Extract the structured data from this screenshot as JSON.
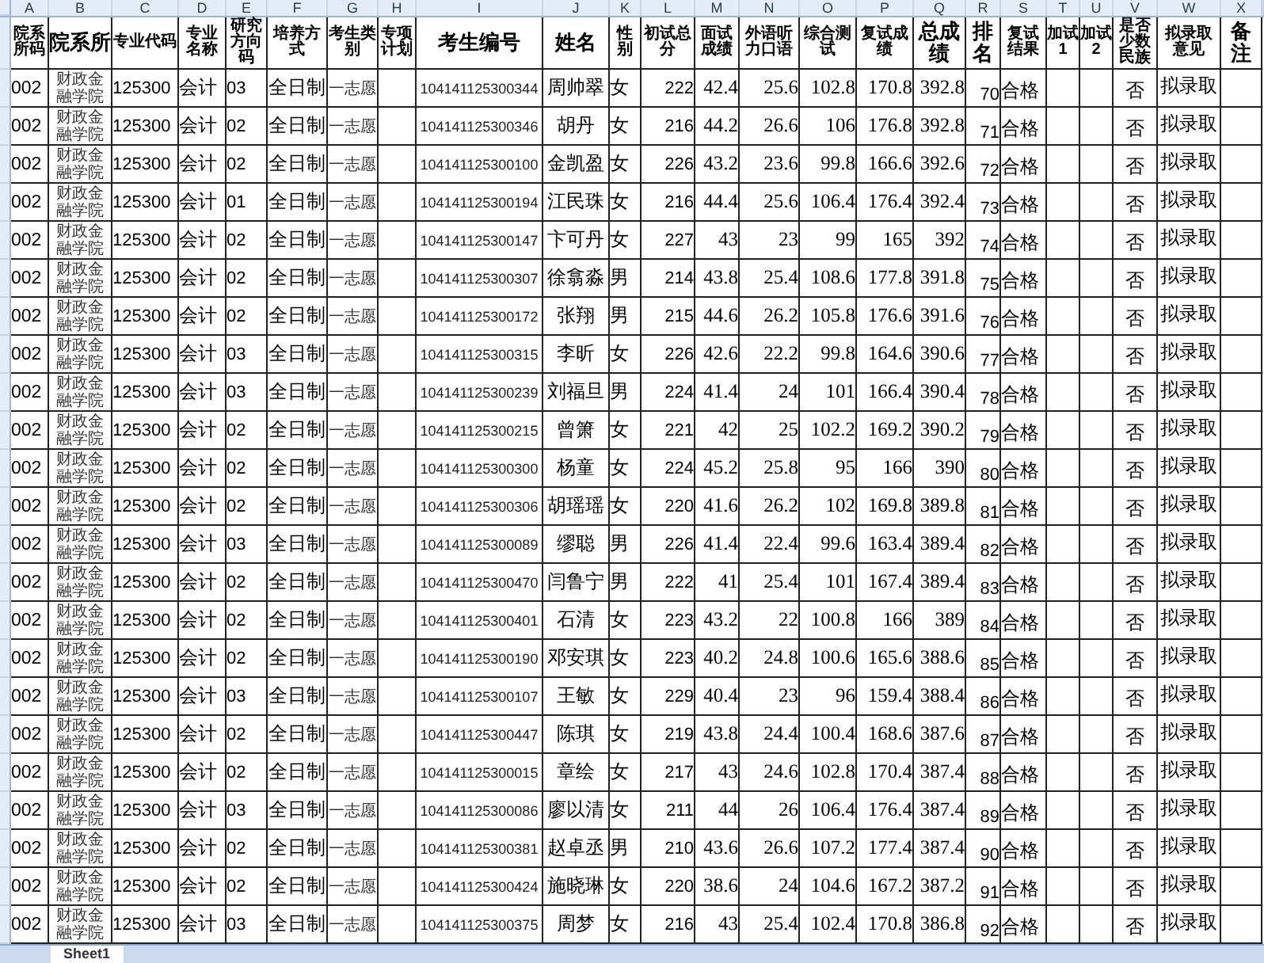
{
  "sheet": {
    "column_letters": [
      "A",
      "B",
      "C",
      "D",
      "E",
      "F",
      "G",
      "H",
      "I",
      "J",
      "K",
      "L",
      "M",
      "N",
      "O",
      "P",
      "Q",
      "R",
      "S",
      "T",
      "U",
      "V",
      "W",
      "X"
    ],
    "headers": [
      "院系所码",
      "院系所",
      "专业代码",
      "专业名称",
      "研究方向码",
      "培养方式",
      "考生类别",
      "专项计划",
      "考生编号",
      "姓名",
      "性别",
      "初试总分",
      "面试成绩",
      "外语听力口语",
      "综合测试",
      "复试成绩",
      "总成绩",
      "排名",
      "复试结果",
      "加试1",
      "加试2",
      "是否少数民族",
      "拟录取意见",
      "备注"
    ],
    "rows": [
      {
        "dept_code": "002",
        "dept": "财政金融学院",
        "major_code": "125300",
        "major": "会计",
        "direction": "03",
        "mode": "全日制",
        "category": "一志愿",
        "exam_id": "104141125300344",
        "name": "周帅翠",
        "gender": "女",
        "initial_total": "222",
        "column_m": "42.4",
        "column_n": "25.6",
        "comprehensive": "102.8",
        "retest": "170.8",
        "total": "392.8",
        "rank": "70",
        "result": "合格",
        "column_v": "否",
        "decision": "拟录取"
      },
      {
        "dept_code": "002",
        "dept": "财政金融学院",
        "major_code": "125300",
        "major": "会计",
        "direction": "02",
        "mode": "全日制",
        "category": "一志愿",
        "exam_id": "104141125300346",
        "name": "胡丹",
        "gender": "女",
        "initial_total": "216",
        "column_m": "44.2",
        "column_n": "26.6",
        "comprehensive": "106",
        "retest": "176.8",
        "total": "392.8",
        "rank": "71",
        "result": "合格",
        "column_v": "否",
        "decision": "拟录取"
      },
      {
        "dept_code": "002",
        "dept": "财政金融学院",
        "major_code": "125300",
        "major": "会计",
        "direction": "02",
        "mode": "全日制",
        "category": "一志愿",
        "exam_id": "104141125300100",
        "name": "金凯盈",
        "gender": "女",
        "initial_total": "226",
        "column_m": "43.2",
        "column_n": "23.6",
        "comprehensive": "99.8",
        "retest": "166.6",
        "total": "392.6",
        "rank": "72",
        "result": "合格",
        "column_v": "否",
        "decision": "拟录取"
      },
      {
        "dept_code": "002",
        "dept": "财政金融学院",
        "major_code": "125300",
        "major": "会计",
        "direction": "01",
        "mode": "全日制",
        "category": "一志愿",
        "exam_id": "104141125300194",
        "name": "江民珠",
        "gender": "女",
        "initial_total": "216",
        "column_m": "44.4",
        "column_n": "25.6",
        "comprehensive": "106.4",
        "retest": "176.4",
        "total": "392.4",
        "rank": "73",
        "result": "合格",
        "column_v": "否",
        "decision": "拟录取"
      },
      {
        "dept_code": "002",
        "dept": "财政金融学院",
        "major_code": "125300",
        "major": "会计",
        "direction": "02",
        "mode": "全日制",
        "category": "一志愿",
        "exam_id": "104141125300147",
        "name": "卞可丹",
        "gender": "女",
        "initial_total": "227",
        "column_m": "43",
        "column_n": "23",
        "comprehensive": "99",
        "retest": "165",
        "total": "392",
        "rank": "74",
        "result": "合格",
        "column_v": "否",
        "decision": "拟录取"
      },
      {
        "dept_code": "002",
        "dept": "财政金融学院",
        "major_code": "125300",
        "major": "会计",
        "direction": "02",
        "mode": "全日制",
        "category": "一志愿",
        "exam_id": "104141125300307",
        "name": "徐翕淼",
        "gender": "男",
        "initial_total": "214",
        "column_m": "43.8",
        "column_n": "25.4",
        "comprehensive": "108.6",
        "retest": "177.8",
        "total": "391.8",
        "rank": "75",
        "result": "合格",
        "column_v": "否",
        "decision": "拟录取"
      },
      {
        "dept_code": "002",
        "dept": "财政金融学院",
        "major_code": "125300",
        "major": "会计",
        "direction": "02",
        "mode": "全日制",
        "category": "一志愿",
        "exam_id": "104141125300172",
        "name": "张翔",
        "gender": "男",
        "initial_total": "215",
        "column_m": "44.6",
        "column_n": "26.2",
        "comprehensive": "105.8",
        "retest": "176.6",
        "total": "391.6",
        "rank": "76",
        "result": "合格",
        "column_v": "否",
        "decision": "拟录取"
      },
      {
        "dept_code": "002",
        "dept": "财政金融学院",
        "major_code": "125300",
        "major": "会计",
        "direction": "03",
        "mode": "全日制",
        "category": "一志愿",
        "exam_id": "104141125300315",
        "name": "李昕",
        "gender": "女",
        "initial_total": "226",
        "column_m": "42.6",
        "column_n": "22.2",
        "comprehensive": "99.8",
        "retest": "164.6",
        "total": "390.6",
        "rank": "77",
        "result": "合格",
        "column_v": "否",
        "decision": "拟录取"
      },
      {
        "dept_code": "002",
        "dept": "财政金融学院",
        "major_code": "125300",
        "major": "会计",
        "direction": "03",
        "mode": "全日制",
        "category": "一志愿",
        "exam_id": "104141125300239",
        "name": "刘福旦",
        "gender": "男",
        "initial_total": "224",
        "column_m": "41.4",
        "column_n": "24",
        "comprehensive": "101",
        "retest": "166.4",
        "total": "390.4",
        "rank": "78",
        "result": "合格",
        "column_v": "否",
        "decision": "拟录取"
      },
      {
        "dept_code": "002",
        "dept": "财政金融学院",
        "major_code": "125300",
        "major": "会计",
        "direction": "02",
        "mode": "全日制",
        "category": "一志愿",
        "exam_id": "104141125300215",
        "name": "曾箫",
        "gender": "女",
        "initial_total": "221",
        "column_m": "42",
        "column_n": "25",
        "comprehensive": "102.2",
        "retest": "169.2",
        "total": "390.2",
        "rank": "79",
        "result": "合格",
        "column_v": "否",
        "decision": "拟录取"
      },
      {
        "dept_code": "002",
        "dept": "财政金融学院",
        "major_code": "125300",
        "major": "会计",
        "direction": "02",
        "mode": "全日制",
        "category": "一志愿",
        "exam_id": "104141125300300",
        "name": "杨童",
        "gender": "女",
        "initial_total": "224",
        "column_m": "45.2",
        "column_n": "25.8",
        "comprehensive": "95",
        "retest": "166",
        "total": "390",
        "rank": "80",
        "result": "合格",
        "column_v": "否",
        "decision": "拟录取"
      },
      {
        "dept_code": "002",
        "dept": "财政金融学院",
        "major_code": "125300",
        "major": "会计",
        "direction": "02",
        "mode": "全日制",
        "category": "一志愿",
        "exam_id": "104141125300306",
        "name": "胡瑶瑶",
        "gender": "女",
        "initial_total": "220",
        "column_m": "41.6",
        "column_n": "26.2",
        "comprehensive": "102",
        "retest": "169.8",
        "total": "389.8",
        "rank": "81",
        "result": "合格",
        "column_v": "否",
        "decision": "拟录取"
      },
      {
        "dept_code": "002",
        "dept": "财政金融学院",
        "major_code": "125300",
        "major": "会计",
        "direction": "03",
        "mode": "全日制",
        "category": "一志愿",
        "exam_id": "104141125300089",
        "name": "缪聪",
        "gender": "男",
        "initial_total": "226",
        "column_m": "41.4",
        "column_n": "22.4",
        "comprehensive": "99.6",
        "retest": "163.4",
        "total": "389.4",
        "rank": "82",
        "result": "合格",
        "column_v": "否",
        "decision": "拟录取"
      },
      {
        "dept_code": "002",
        "dept": "财政金融学院",
        "major_code": "125300",
        "major": "会计",
        "direction": "02",
        "mode": "全日制",
        "category": "一志愿",
        "exam_id": "104141125300470",
        "name": "闫鲁宁",
        "gender": "男",
        "initial_total": "222",
        "column_m": "41",
        "column_n": "25.4",
        "comprehensive": "101",
        "retest": "167.4",
        "total": "389.4",
        "rank": "83",
        "result": "合格",
        "column_v": "否",
        "decision": "拟录取"
      },
      {
        "dept_code": "002",
        "dept": "财政金融学院",
        "major_code": "125300",
        "major": "会计",
        "direction": "02",
        "mode": "全日制",
        "category": "一志愿",
        "exam_id": "104141125300401",
        "name": "石清",
        "gender": "女",
        "initial_total": "223",
        "column_m": "43.2",
        "column_n": "22",
        "comprehensive": "100.8",
        "retest": "166",
        "total": "389",
        "rank": "84",
        "result": "合格",
        "column_v": "否",
        "decision": "拟录取"
      },
      {
        "dept_code": "002",
        "dept": "财政金融学院",
        "major_code": "125300",
        "major": "会计",
        "direction": "02",
        "mode": "全日制",
        "category": "一志愿",
        "exam_id": "104141125300190",
        "name": "邓安琪",
        "gender": "女",
        "initial_total": "223",
        "column_m": "40.2",
        "column_n": "24.8",
        "comprehensive": "100.6",
        "retest": "165.6",
        "total": "388.6",
        "rank": "85",
        "result": "合格",
        "column_v": "否",
        "decision": "拟录取"
      },
      {
        "dept_code": "002",
        "dept": "财政金融学院",
        "major_code": "125300",
        "major": "会计",
        "direction": "03",
        "mode": "全日制",
        "category": "一志愿",
        "exam_id": "104141125300107",
        "name": "王敏",
        "gender": "女",
        "initial_total": "229",
        "column_m": "40.4",
        "column_n": "23",
        "comprehensive": "96",
        "retest": "159.4",
        "total": "388.4",
        "rank": "86",
        "result": "合格",
        "column_v": "否",
        "decision": "拟录取"
      },
      {
        "dept_code": "002",
        "dept": "财政金融学院",
        "major_code": "125300",
        "major": "会计",
        "direction": "02",
        "mode": "全日制",
        "category": "一志愿",
        "exam_id": "104141125300447",
        "name": "陈琪",
        "gender": "女",
        "initial_total": "219",
        "column_m": "43.8",
        "column_n": "24.4",
        "comprehensive": "100.4",
        "retest": "168.6",
        "total": "387.6",
        "rank": "87",
        "result": "合格",
        "column_v": "否",
        "decision": "拟录取"
      },
      {
        "dept_code": "002",
        "dept": "财政金融学院",
        "major_code": "125300",
        "major": "会计",
        "direction": "02",
        "mode": "全日制",
        "category": "一志愿",
        "exam_id": "104141125300015",
        "name": "章绘",
        "gender": "女",
        "initial_total": "217",
        "column_m": "43",
        "column_n": "24.6",
        "comprehensive": "102.8",
        "retest": "170.4",
        "total": "387.4",
        "rank": "88",
        "result": "合格",
        "column_v": "否",
        "decision": "拟录取"
      },
      {
        "dept_code": "002",
        "dept": "财政金融学院",
        "major_code": "125300",
        "major": "会计",
        "direction": "03",
        "mode": "全日制",
        "category": "一志愿",
        "exam_id": "104141125300086",
        "name": "廖以清",
        "gender": "女",
        "initial_total": "211",
        "column_m": "44",
        "column_n": "26",
        "comprehensive": "106.4",
        "retest": "176.4",
        "total": "387.4",
        "rank": "89",
        "result": "合格",
        "column_v": "否",
        "decision": "拟录取"
      },
      {
        "dept_code": "002",
        "dept": "财政金融学院",
        "major_code": "125300",
        "major": "会计",
        "direction": "02",
        "mode": "全日制",
        "category": "一志愿",
        "exam_id": "104141125300381",
        "name": "赵卓丞",
        "gender": "男",
        "initial_total": "210",
        "column_m": "43.6",
        "column_n": "26.6",
        "comprehensive": "107.2",
        "retest": "177.4",
        "total": "387.4",
        "rank": "90",
        "result": "合格",
        "column_v": "否",
        "decision": "拟录取"
      },
      {
        "dept_code": "002",
        "dept": "财政金融学院",
        "major_code": "125300",
        "major": "会计",
        "direction": "02",
        "mode": "全日制",
        "category": "一志愿",
        "exam_id": "104141125300424",
        "name": "施晓琳",
        "gender": "女",
        "initial_total": "220",
        "column_m": "38.6",
        "column_n": "24",
        "comprehensive": "104.6",
        "retest": "167.2",
        "total": "387.2",
        "rank": "91",
        "result": "合格",
        "column_v": "否",
        "decision": "拟录取"
      },
      {
        "dept_code": "002",
        "dept": "财政金融学院",
        "major_code": "125300",
        "major": "会计",
        "direction": "03",
        "mode": "全日制",
        "category": "一志愿",
        "exam_id": "104141125300375",
        "name": "周梦",
        "gender": "女",
        "initial_total": "216",
        "column_m": "43",
        "column_n": "25.4",
        "comprehensive": "102.4",
        "retest": "170.8",
        "total": "386.8",
        "rank": "92",
        "result": "合格",
        "column_v": "否",
        "decision": "拟录取"
      }
    ]
  },
  "sheet_tabs": [
    {
      "label": "Sheet1",
      "selected": true
    }
  ]
}
